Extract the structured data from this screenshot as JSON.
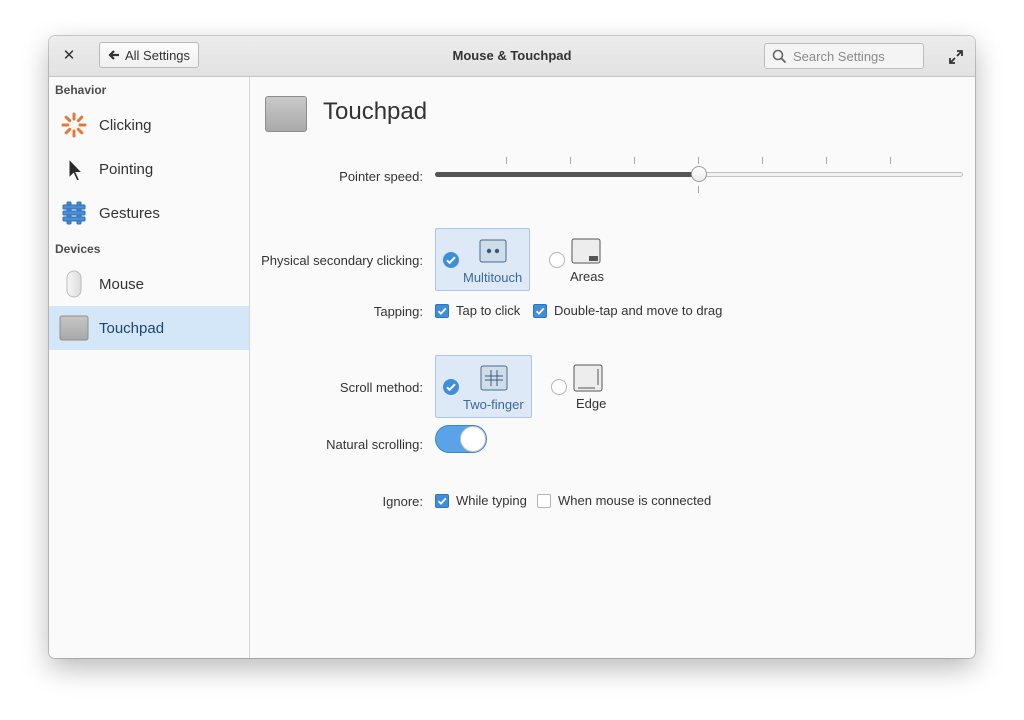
{
  "window": {
    "title": "Mouse & Touchpad",
    "back_label": "All Settings",
    "search_placeholder": "Search Settings"
  },
  "sidebar": {
    "sections": [
      {
        "heading": "Behavior",
        "items": [
          {
            "label": "Clicking",
            "icon": "clicking-icon"
          },
          {
            "label": "Pointing",
            "icon": "pointer-icon"
          },
          {
            "label": "Gestures",
            "icon": "gestures-icon"
          }
        ]
      },
      {
        "heading": "Devices",
        "items": [
          {
            "label": "Mouse",
            "icon": "mouse-icon"
          },
          {
            "label": "Touchpad",
            "icon": "touchpad-icon",
            "selected": true
          }
        ]
      }
    ]
  },
  "page": {
    "title": "Touchpad",
    "pointer_speed": {
      "label": "Pointer speed:",
      "value": 0.5
    },
    "secondary_click": {
      "label": "Physical secondary clicking:",
      "options": [
        {
          "label": "Multitouch",
          "selected": true
        },
        {
          "label": "Areas",
          "selected": false
        }
      ]
    },
    "tapping": {
      "label": "Tapping:",
      "options": [
        {
          "label": "Tap to click",
          "checked": true
        },
        {
          "label": "Double-tap and move to drag",
          "checked": true
        }
      ]
    },
    "scroll_method": {
      "label": "Scroll method:",
      "options": [
        {
          "label": "Two-finger",
          "selected": true
        },
        {
          "label": "Edge",
          "selected": false
        }
      ]
    },
    "natural_scrolling": {
      "label": "Natural scrolling:",
      "on": true
    },
    "ignore": {
      "label": "Ignore:",
      "options": [
        {
          "label": "While typing",
          "checked": true
        },
        {
          "label": "When mouse is connected",
          "checked": false
        }
      ]
    }
  },
  "colors": {
    "accent": "#3f8edb",
    "selection": "#d3e7f9"
  }
}
